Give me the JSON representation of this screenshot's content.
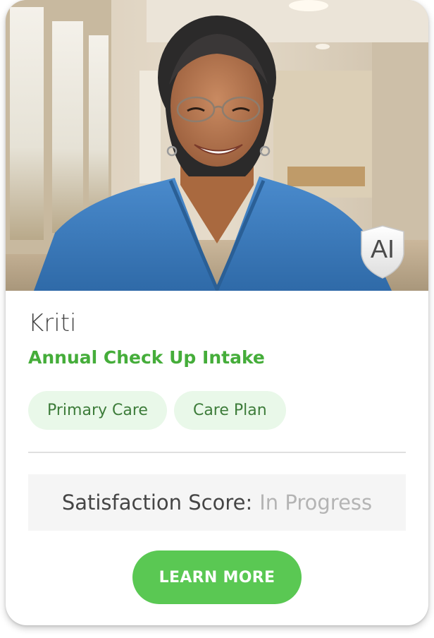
{
  "profile": {
    "name": "Kriti",
    "title": "Annual Check Up Intake",
    "tags": [
      "Primary Care",
      "Care Plan"
    ],
    "badge": "AI"
  },
  "satisfaction": {
    "label": "Satisfaction Score:",
    "value": "In Progress"
  },
  "cta": {
    "label": "LEARN MORE"
  },
  "colors": {
    "accent_green": "#45ad3a",
    "button_green": "#5ac853",
    "tag_bg": "#e9f8e9",
    "tag_text": "#3d7c3a",
    "scrubs_blue": "#3a7cc0"
  }
}
